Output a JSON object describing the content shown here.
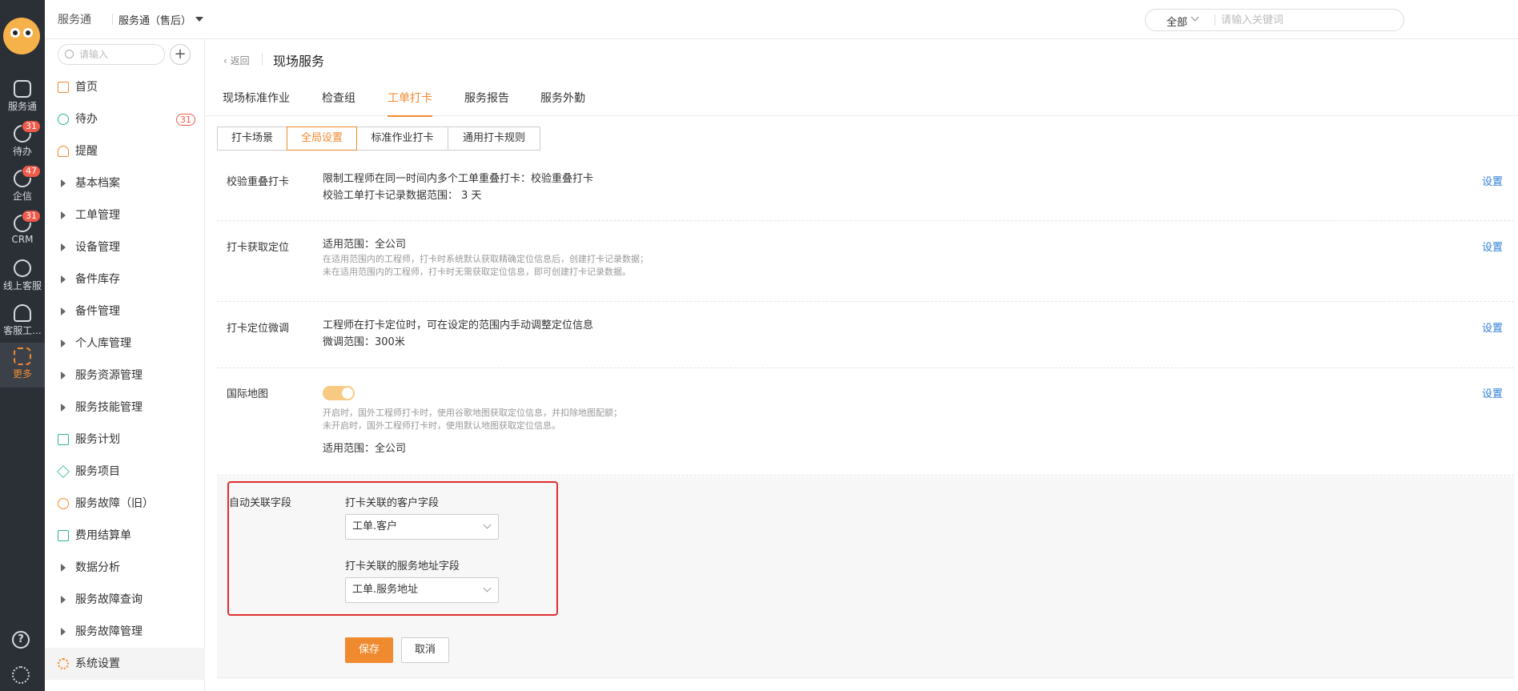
{
  "rail": {
    "items": [
      {
        "label": "服务通",
        "badge": ""
      },
      {
        "label": "待办",
        "badge": "31"
      },
      {
        "label": "企信",
        "badge": "47"
      },
      {
        "label": "CRM",
        "badge": "31"
      },
      {
        "label": "线上客服",
        "badge": ""
      },
      {
        "label": "客服工...",
        "badge": ""
      },
      {
        "label": "更多",
        "badge": ""
      }
    ],
    "help_glyph": "?",
    "accent_color": "#f08a2f"
  },
  "header": {
    "title": "服务通",
    "app_switcher": "服务通（售后）",
    "search_scope": "全部",
    "search_placeholder": "请输入关键词"
  },
  "sidebar": {
    "search_placeholder": "请输入",
    "add_glyph": "+",
    "items": [
      {
        "label": "首页",
        "count": ""
      },
      {
        "label": "待办",
        "count": "31"
      },
      {
        "label": "提醒",
        "count": ""
      },
      {
        "label": "基本档案",
        "count": ""
      },
      {
        "label": "工单管理",
        "count": ""
      },
      {
        "label": "设备管理",
        "count": ""
      },
      {
        "label": "备件库存",
        "count": ""
      },
      {
        "label": "备件管理",
        "count": ""
      },
      {
        "label": "个人库管理",
        "count": ""
      },
      {
        "label": "服务资源管理",
        "count": ""
      },
      {
        "label": "服务技能管理",
        "count": ""
      },
      {
        "label": "服务计划",
        "count": ""
      },
      {
        "label": "服务项目",
        "count": ""
      },
      {
        "label": "服务故障（旧）",
        "count": ""
      },
      {
        "label": "费用结算单",
        "count": ""
      },
      {
        "label": "数据分析",
        "count": ""
      },
      {
        "label": "服务故障查询",
        "count": ""
      },
      {
        "label": "服务故障管理",
        "count": ""
      },
      {
        "label": "系统设置",
        "count": ""
      }
    ]
  },
  "breadcrumb": {
    "back": "返回",
    "title": "现场服务"
  },
  "tabs": [
    "现场标准作业",
    "检查组",
    "工单打卡",
    "服务报告",
    "服务外勤"
  ],
  "subtabs": [
    "打卡场景",
    "全局设置",
    "标准作业打卡",
    "通用打卡规则"
  ],
  "settings": {
    "set_label": "设置",
    "rows": [
      {
        "label": "校验重叠打卡",
        "line1": "限制工程师在同一时间内多个工单重叠打卡：校验重叠打卡",
        "line2": "校验工单打卡记录数据范围： 3 天"
      },
      {
        "label": "打卡获取定位",
        "line1": "适用范围：全公司",
        "hint1": "在适用范围内的工程师，打卡时系统默认获取精确定位信息后，创建打卡记录数据；",
        "hint2": "未在适用范围内的工程师，打卡时无需获取定位信息，即可创建打卡记录数据。"
      },
      {
        "label": "打卡定位微调",
        "line1": "工程师在打卡定位时，可在设定的范围内手动调整定位信息",
        "line2": "微调范围：300米"
      },
      {
        "label": "国际地图",
        "hint1": "开启时，国外工程师打卡时，使用谷歌地图获取定位信息，并扣除地图配额；",
        "hint2": "未开启时，国外工程师打卡时，使用默认地图获取定位信息。",
        "line1": "适用范围：全公司"
      }
    ]
  },
  "auto_link": {
    "label": "自动关联字段",
    "customer_field_label": "打卡关联的客户字段",
    "customer_field_value": "工单.客户",
    "address_field_label": "打卡关联的服务地址字段",
    "address_field_value": "工单.服务地址",
    "save": "保存",
    "cancel": "取消"
  }
}
